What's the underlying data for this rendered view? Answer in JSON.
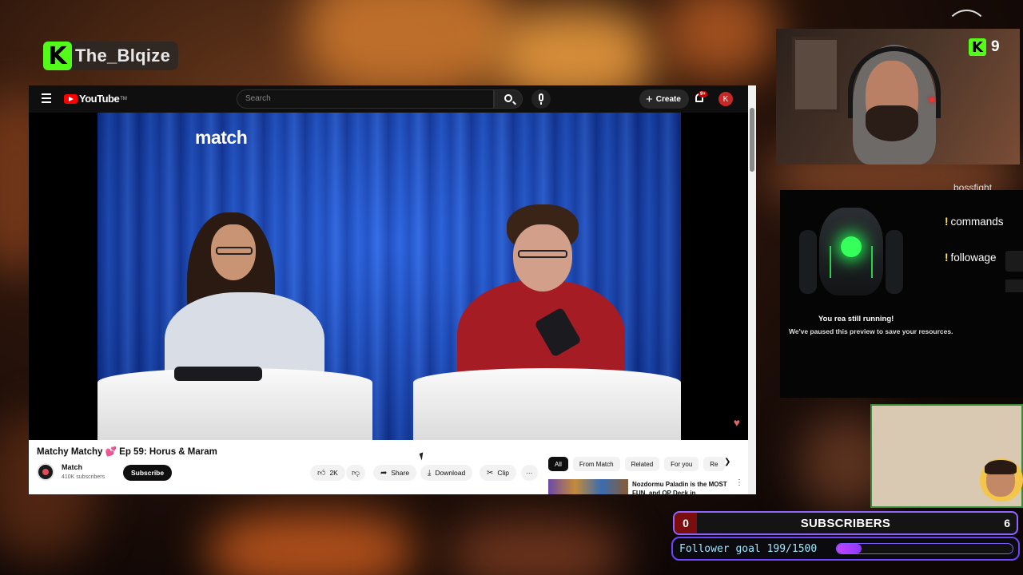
{
  "overlay": {
    "streamer_name": "The_Blqize",
    "viewer_count": "9",
    "kick_letter": "K"
  },
  "youtube": {
    "logo_text": "YouTube",
    "logo_tm": "TM",
    "search_placeholder": "Search",
    "create_label": "Create",
    "notification_count": "9+",
    "account_initial": "K",
    "video_channel_logo": "match",
    "video_title_start": "Matchy Matchy",
    "video_title_emoji": "💕",
    "video_title_end": "Ep 59: Horus & Maram",
    "channel": {
      "name": "Match",
      "subscribers": "410K subscribers",
      "subscribe_label": "Subscribe"
    },
    "actions": {
      "likes": "2K",
      "share": "Share",
      "download": "Download",
      "clip": "Clip",
      "more": "···"
    },
    "chips": [
      "All",
      "From Match",
      "Related",
      "For you",
      "Re"
    ],
    "recommended": {
      "title": "Nozdormu Paladin is the MOST FUN, and OP Deck in"
    }
  },
  "commands_panel": {
    "partial_top": "bossfight",
    "commands": [
      "commands",
      "followage"
    ],
    "partial_bottom": "f...",
    "paused_line1": "You   rea    still running!",
    "paused_line2": "We've paused this preview to save your resources."
  },
  "subscribers": {
    "current": "0",
    "label": "SUBSCRIBERS",
    "goal": "6"
  },
  "follower_goal": {
    "text": "Follower goal 199/1500",
    "current": 199,
    "target": 1500
  },
  "colors": {
    "kick_green": "#53fc18",
    "youtube_red": "#ff0000",
    "goal_purple": "#8e66ff"
  }
}
